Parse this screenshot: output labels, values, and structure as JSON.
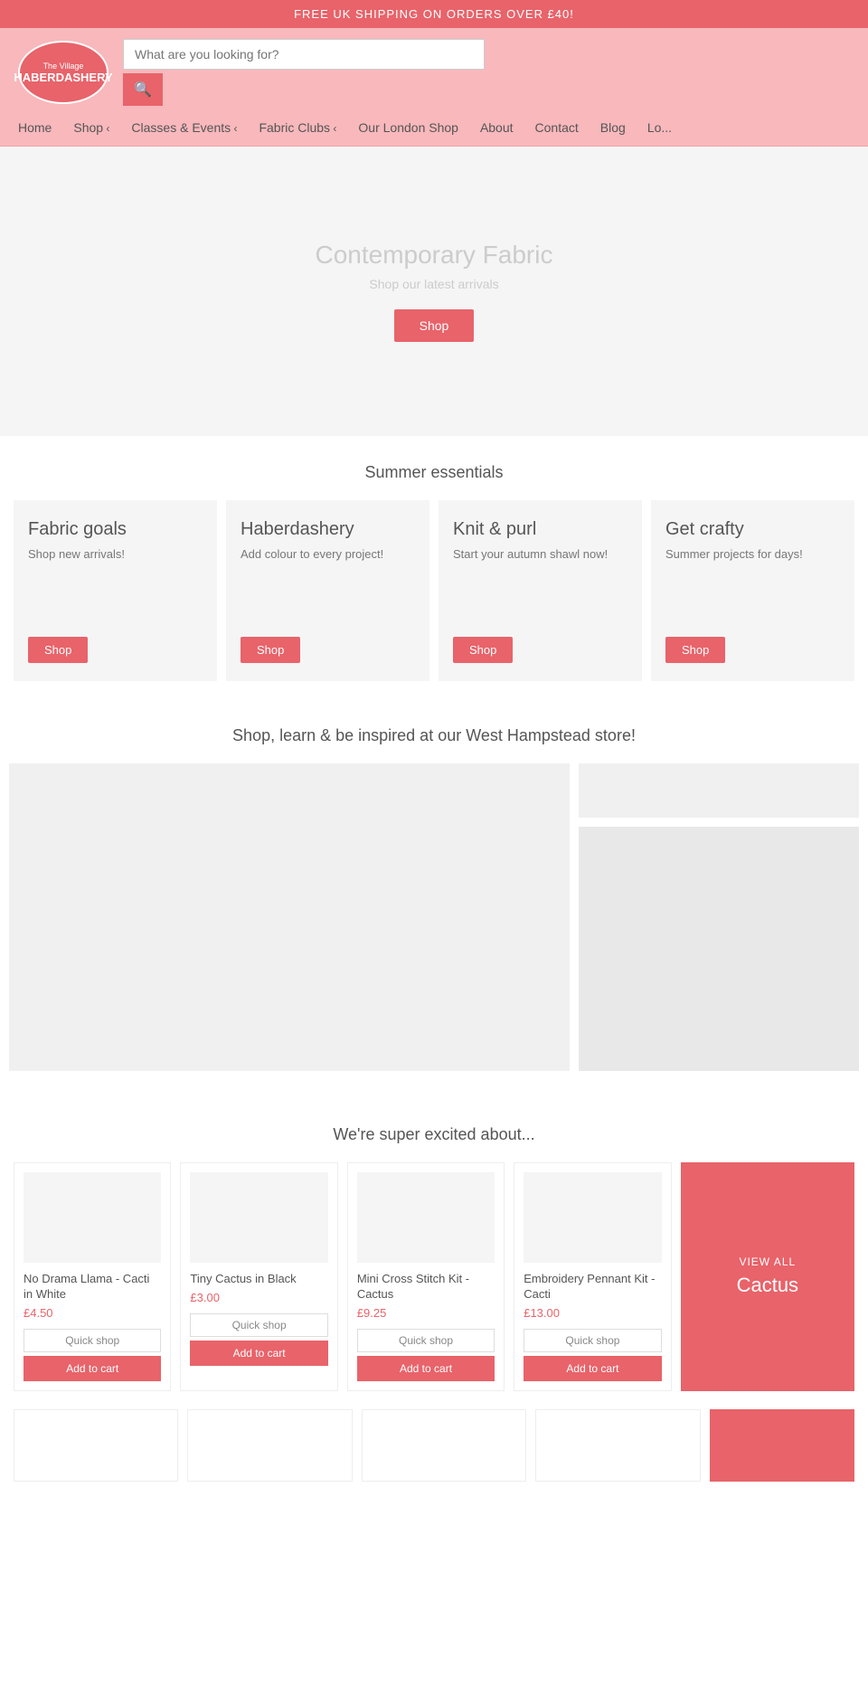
{
  "banner": {
    "text": "FREE UK SHIPPING ON ORDERS OVER £40!"
  },
  "logo": {
    "top": "The Village",
    "main": "HABERDASHERY"
  },
  "search": {
    "placeholder": "What are you looking for?"
  },
  "nav": {
    "items": [
      {
        "label": "Home",
        "dropdown": false
      },
      {
        "label": "Shop",
        "dropdown": true
      },
      {
        "label": "Classes & Events",
        "dropdown": true
      },
      {
        "label": "Fabric Clubs",
        "dropdown": true
      },
      {
        "label": "Our London Shop",
        "dropdown": false
      },
      {
        "label": "About",
        "dropdown": false
      },
      {
        "label": "Contact",
        "dropdown": false
      },
      {
        "label": "Blog",
        "dropdown": false
      },
      {
        "label": "Lo...",
        "dropdown": false
      }
    ]
  },
  "hero": {
    "title": "Contemporary Fabric",
    "subtitle": "Shop our latest arrivals",
    "cta": "Shop"
  },
  "summer_section": {
    "title": "Summer essentials",
    "cards": [
      {
        "title": "Fabric goals",
        "desc": "Shop new arrivals!",
        "btn": "Shop"
      },
      {
        "title": "Haberdashery",
        "desc": "Add colour to every project!",
        "btn": "Shop"
      },
      {
        "title": "Knit & purl",
        "desc": "Start your autumn shawl now!",
        "btn": "Shop"
      },
      {
        "title": "Get crafty",
        "desc": "Summer projects for days!",
        "btn": "Shop"
      }
    ]
  },
  "store_section": {
    "title": "Shop, learn & be inspired at our West Hampstead store!"
  },
  "excited_section": {
    "title": "We're super excited about...",
    "products": [
      {
        "name": "No Drama Llama - Cacti in White",
        "price": "£4.50",
        "quick_shop": "Quick shop",
        "add_cart": "Add to cart"
      },
      {
        "name": "Tiny Cactus in Black",
        "price": "£3.00",
        "quick_shop": "Quick shop",
        "add_cart": "Add to cart"
      },
      {
        "name": "Mini Cross Stitch Kit - Cactus",
        "price": "£9.25",
        "quick_shop": "Quick shop",
        "add_cart": "Add to cart"
      },
      {
        "name": "Embroidery Pennant Kit - Cacti",
        "price": "£13.00",
        "quick_shop": "Quick shop",
        "add_cart": "Add to cart"
      }
    ],
    "view_all": {
      "label": "VIEW ALL",
      "title": "Cactus"
    }
  }
}
